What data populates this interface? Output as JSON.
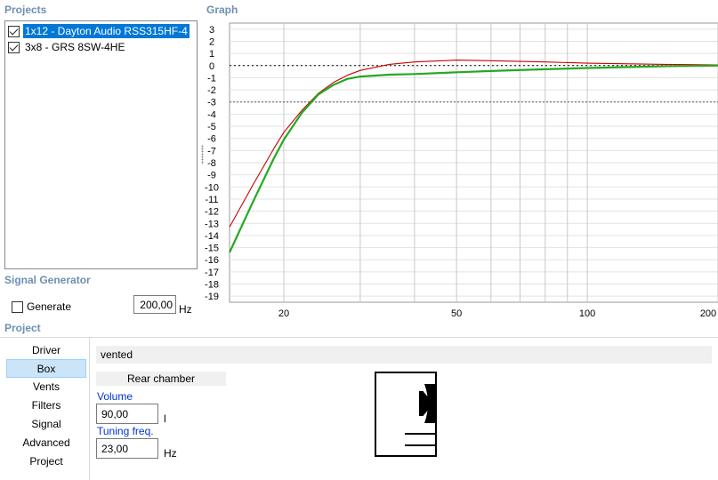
{
  "sections": {
    "projects": "Projects",
    "graph": "Graph",
    "signal_generator": "Signal Generator",
    "project": "Project"
  },
  "projects": [
    {
      "label": "1x12 - Dayton Audio RSS315HF-4",
      "checked": true,
      "selected": true
    },
    {
      "label": "3x8 - GRS 8SW-4HE",
      "checked": true,
      "selected": false
    }
  ],
  "signal_generator": {
    "generate_label": "Generate",
    "generate_checked": false,
    "frequency": "200,00",
    "frequency_unit": "Hz"
  },
  "nav": {
    "items": [
      "Driver",
      "Box",
      "Vents",
      "Filters",
      "Signal",
      "Advanced",
      "Project"
    ],
    "selected": "Box"
  },
  "box": {
    "type": "vented",
    "rear_chamber": "Rear chamber",
    "volume_label": "Volume",
    "volume_value": "90,00",
    "volume_unit": "l",
    "tuning_label": "Tuning freq.",
    "tuning_value": "23,00",
    "tuning_unit": "Hz"
  },
  "chart_data": {
    "type": "line",
    "title": "",
    "xlabel": "",
    "ylabel": "",
    "xscale": "log",
    "xlim": [
      15,
      200
    ],
    "ylim": [
      -19.5,
      3.5
    ],
    "x_ticks": [
      20,
      50,
      100,
      200
    ],
    "x_gridlines": [
      20,
      30,
      40,
      50,
      60,
      70,
      80,
      90,
      100,
      200
    ],
    "y_ticks": [
      3,
      2,
      1,
      0,
      -1,
      -2,
      -3,
      -4,
      -5,
      -6,
      -7,
      -8,
      -9,
      -10,
      -11,
      -12,
      -13,
      -14,
      -15,
      -16,
      -17,
      -18,
      -19
    ],
    "reference_lines": [
      0,
      -3
    ],
    "grid": true,
    "legend": "none",
    "series": [
      {
        "color": "#cc0000",
        "x": [
          15,
          17,
          19,
          20,
          22,
          24,
          26,
          28,
          30,
          35,
          40,
          50,
          60,
          80,
          100,
          150,
          200
        ],
        "y": [
          -13.3,
          -9.8,
          -6.8,
          -5.5,
          -3.7,
          -2.3,
          -1.4,
          -0.8,
          -0.4,
          0.1,
          0.3,
          0.45,
          0.4,
          0.3,
          0.2,
          0.1,
          0.05
        ]
      },
      {
        "color": "#22aa22",
        "x": [
          15,
          17,
          19,
          20,
          22,
          24,
          26,
          28,
          30,
          35,
          40,
          50,
          60,
          80,
          100,
          150,
          200
        ],
        "y": [
          -15.4,
          -11.2,
          -7.6,
          -6.1,
          -3.9,
          -2.4,
          -1.6,
          -1.1,
          -0.9,
          -0.75,
          -0.7,
          -0.55,
          -0.45,
          -0.3,
          -0.2,
          -0.05,
          0
        ]
      }
    ]
  },
  "colors": {
    "section_title": "#6d8fb3",
    "selection": "#0078d7",
    "nav_selected": "#cce4f7",
    "field_label": "#0033cc"
  }
}
